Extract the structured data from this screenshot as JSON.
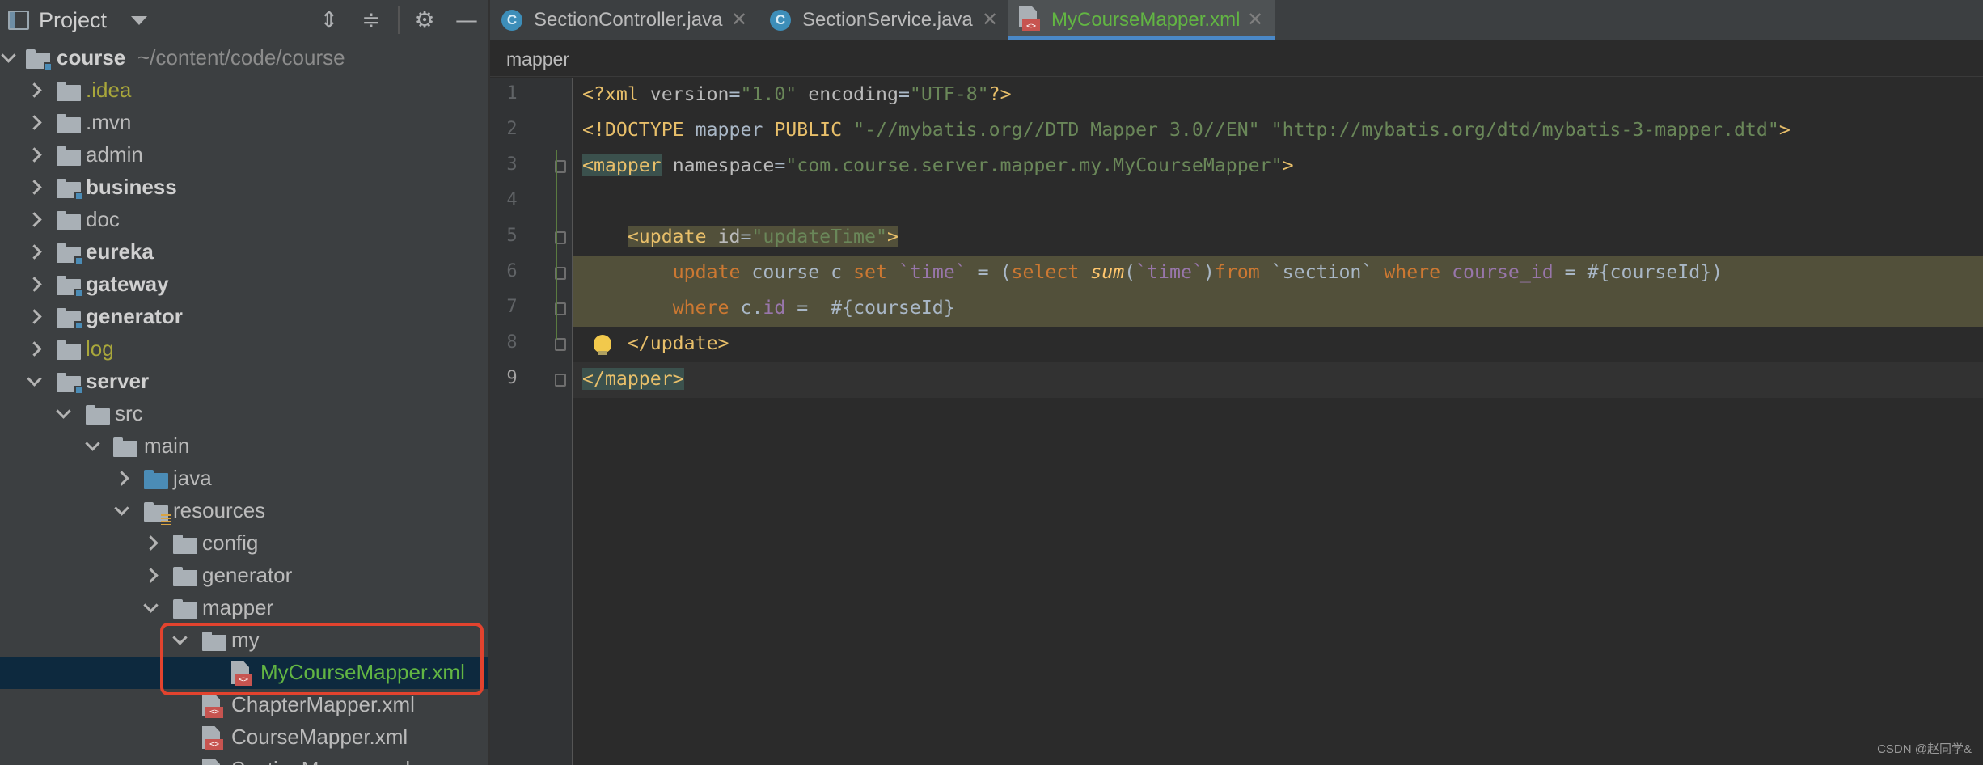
{
  "sidebar": {
    "title": "Project",
    "tools": [
      "expand-all-icon",
      "collapse-all-icon",
      "gear-icon",
      "minimize-icon"
    ],
    "tree": [
      {
        "label": "course",
        "extra": "~/content/code/course",
        "style": "bold"
      },
      {
        "label": ".idea",
        "style": "olive"
      },
      {
        "label": ".mvn",
        "style": "normal"
      },
      {
        "label": "admin",
        "style": "normal"
      },
      {
        "label": "business",
        "style": "bold"
      },
      {
        "label": "doc",
        "style": "normal"
      },
      {
        "label": "eureka",
        "style": "bold"
      },
      {
        "label": "gateway",
        "style": "bold"
      },
      {
        "label": "generator",
        "style": "bold"
      },
      {
        "label": "log",
        "style": "olive"
      },
      {
        "label": "server",
        "style": "bold"
      },
      {
        "label": "src",
        "style": "normal"
      },
      {
        "label": "main",
        "style": "normal"
      },
      {
        "label": "java",
        "style": "normal"
      },
      {
        "label": "resources",
        "style": "normal"
      },
      {
        "label": "config",
        "style": "normal"
      },
      {
        "label": "generator",
        "style": "normal"
      },
      {
        "label": "mapper",
        "style": "normal"
      },
      {
        "label": "my",
        "style": "normal"
      },
      {
        "label": "MyCourseMapper.xml",
        "style": "green"
      },
      {
        "label": "ChapterMapper.xml",
        "style": "normal"
      },
      {
        "label": "CourseMapper.xml",
        "style": "normal"
      },
      {
        "label": "SectionMapper.xml",
        "style": "normal"
      }
    ]
  },
  "tabs": [
    {
      "label": "SectionController.java",
      "icon": "java-class-icon",
      "active": false
    },
    {
      "label": "SectionService.java",
      "icon": "java-class-icon",
      "active": false
    },
    {
      "label": "MyCourseMapper.xml",
      "icon": "xml-file-icon",
      "active": true
    }
  ],
  "breadcrumb": "mapper",
  "editor": {
    "line_numbers": [
      "1",
      "2",
      "3",
      "4",
      "5",
      "6",
      "7",
      "8",
      "9"
    ],
    "lines": [
      "<?xml version=\"1.0\" encoding=\"UTF-8\"?>",
      "<!DOCTYPE mapper PUBLIC \"-//mybatis.org//DTD Mapper 3.0//EN\" \"http://mybatis.org/dtd/mybatis-3-mapper.dtd\">",
      "<mapper namespace=\"com.course.server.mapper.my.MyCourseMapper\">",
      "",
      "    <update id=\"updateTime\">",
      "        update course c set `time` = (select sum(`time`)from `section` where course_id = #{courseId})",
      "        where c.id =  #{courseId}",
      "    </update>",
      "</mapper>"
    ]
  },
  "colors": {
    "accent": "#4a88c7",
    "highlight_box": "#e2432e",
    "selected_row": "#0d293e"
  },
  "watermark": "CSDN @赵同学&"
}
